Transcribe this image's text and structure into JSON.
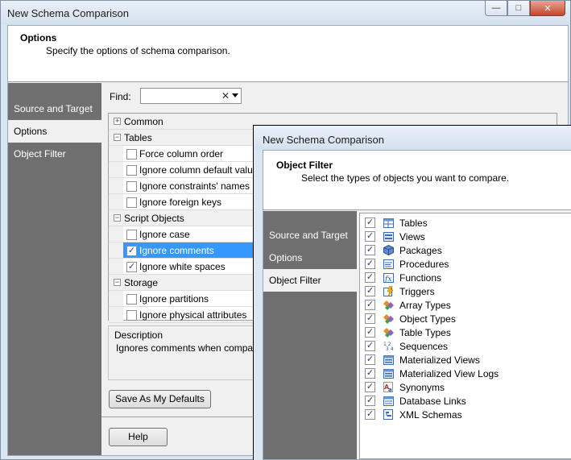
{
  "back_window": {
    "title": "New Schema Comparison",
    "header": {
      "title": "Options",
      "subtitle": "Specify the options of schema comparison."
    },
    "nav": [
      "Source and Target",
      "Options",
      "Object Filter"
    ],
    "find_label": "Find:",
    "find_value": "",
    "groups": [
      {
        "label": "Common",
        "expanded": false,
        "items": []
      },
      {
        "label": "Tables",
        "expanded": true,
        "items": [
          {
            "label": "Force column order",
            "checked": false
          },
          {
            "label": "Ignore column default values",
            "checked": false
          },
          {
            "label": "Ignore constraints' names",
            "checked": false
          },
          {
            "label": "Ignore foreign keys",
            "checked": false
          }
        ]
      },
      {
        "label": "Script Objects",
        "expanded": true,
        "items": [
          {
            "label": "Ignore case",
            "checked": false
          },
          {
            "label": "Ignore comments",
            "checked": true,
            "selected": true
          },
          {
            "label": "Ignore white spaces",
            "checked": true
          }
        ]
      },
      {
        "label": "Storage",
        "expanded": true,
        "items": [
          {
            "label": "Ignore partitions",
            "checked": false
          },
          {
            "label": "Ignore physical attributes",
            "checked": false
          }
        ]
      }
    ],
    "description_title": "Description",
    "description_text": "Ignores comments when comparin body are preserved during synchro",
    "save_defaults_label": "Save As My Defaults",
    "help_label": "Help",
    "window_controls": {
      "minimize": "—",
      "maximize": "□",
      "close": "✕"
    }
  },
  "front_window": {
    "title": "New Schema Comparison",
    "header": {
      "title": "Object Filter",
      "subtitle": "Select the types of objects you want to compare."
    },
    "nav": [
      "Source and Target",
      "Options",
      "Object Filter"
    ],
    "objects": [
      {
        "label": "Tables",
        "checked": true,
        "icon": "table-icon"
      },
      {
        "label": "Views",
        "checked": true,
        "icon": "view-icon"
      },
      {
        "label": "Packages",
        "checked": true,
        "icon": "package-icon"
      },
      {
        "label": "Procedures",
        "checked": true,
        "icon": "procedure-icon"
      },
      {
        "label": "Functions",
        "checked": true,
        "icon": "function-icon"
      },
      {
        "label": "Triggers",
        "checked": true,
        "icon": "trigger-icon"
      },
      {
        "label": "Array Types",
        "checked": true,
        "icon": "array-type-icon"
      },
      {
        "label": "Object Types",
        "checked": true,
        "icon": "object-type-icon"
      },
      {
        "label": "Table Types",
        "checked": true,
        "icon": "table-type-icon"
      },
      {
        "label": "Sequences",
        "checked": true,
        "icon": "sequence-icon"
      },
      {
        "label": "Materialized Views",
        "checked": true,
        "icon": "materialized-view-icon"
      },
      {
        "label": "Materialized View Logs",
        "checked": true,
        "icon": "materialized-view-log-icon"
      },
      {
        "label": "Synonyms",
        "checked": true,
        "icon": "synonym-icon"
      },
      {
        "label": "Database Links",
        "checked": true,
        "icon": "database-link-icon"
      },
      {
        "label": "XML Schemas",
        "checked": true,
        "icon": "xml-schema-icon"
      }
    ]
  }
}
